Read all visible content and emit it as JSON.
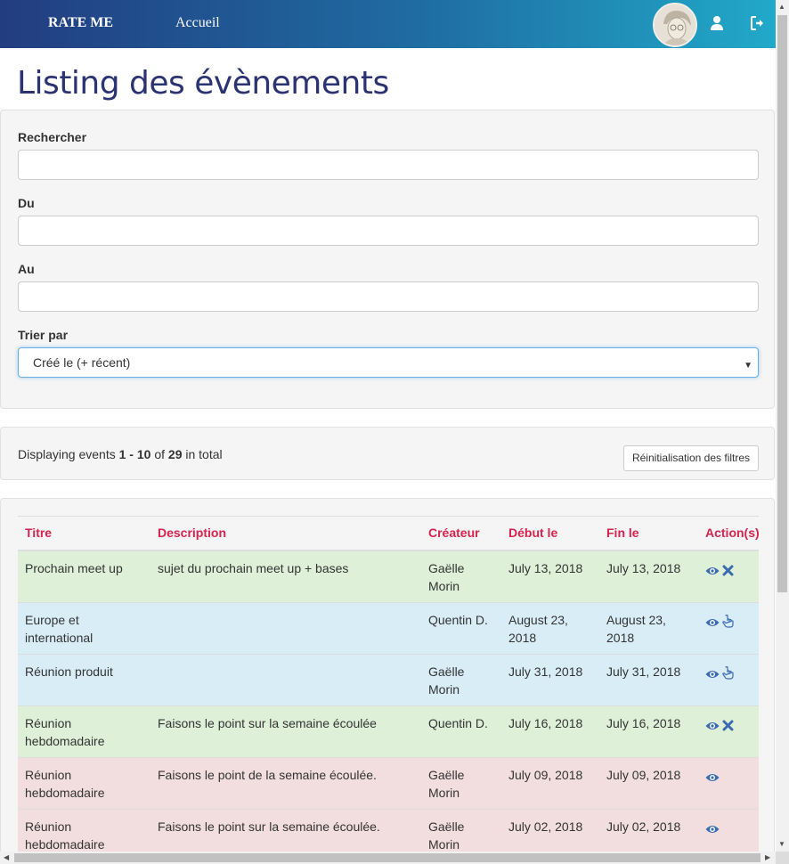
{
  "navbar": {
    "brand": "RATE ME",
    "home_link": "Accueil",
    "avatar_icon": "user-avatar",
    "profile_icon": "user-icon",
    "logout_icon": "sign-out-icon"
  },
  "page": {
    "title": "Listing des évènements"
  },
  "filters": {
    "search_label": "Rechercher",
    "search_value": "",
    "from_label": "Du",
    "from_value": "",
    "to_label": "Au",
    "to_value": "",
    "sort_label": "Trier par",
    "sort_selected": "Créé le (+ récent)"
  },
  "summary": {
    "prefix": "Displaying events ",
    "range": "1 - 10",
    "of": " of ",
    "total": "29",
    "suffix": " in total",
    "reset_label": "Réinitialisation des filtres"
  },
  "table": {
    "headers": [
      "Titre",
      "Description",
      "Créateur",
      "Début le",
      "Fin le",
      "Action(s)"
    ],
    "rows": [
      {
        "status": "success",
        "title": "Prochain meet up",
        "description": "sujet du prochain meet up + bases",
        "creator": "Gaëlle Morin",
        "start": "July 13, 2018",
        "end": "July 13, 2018",
        "actions": [
          "eye-icon",
          "remove-icon"
        ]
      },
      {
        "status": "info",
        "title": "Europe et international",
        "description": "",
        "creator": "Quentin D.",
        "start": "August 23, 2018",
        "end": "August 23, 2018",
        "actions": [
          "eye-icon",
          "hand-pointer-icon"
        ]
      },
      {
        "status": "info",
        "title": "Réunion produit",
        "description": "",
        "creator": "Gaëlle Morin",
        "start": "July 31, 2018",
        "end": "July 31, 2018",
        "actions": [
          "eye-icon",
          "hand-pointer-icon"
        ]
      },
      {
        "status": "success",
        "title": "Réunion hebdomadaire",
        "description": "Faisons le point sur la semaine écoulée",
        "creator": "Quentin D.",
        "start": "July 16, 2018",
        "end": "July 16, 2018",
        "actions": [
          "eye-icon",
          "remove-icon"
        ]
      },
      {
        "status": "danger",
        "title": "Réunion hebdomadaire",
        "description": "Faisons le point de la semaine écoulée.",
        "creator": "Gaëlle Morin",
        "start": "July 09, 2018",
        "end": "July 09, 2018",
        "actions": [
          "eye-icon"
        ]
      },
      {
        "status": "danger",
        "title": "Réunion hebdomadaire",
        "description": "Faisons le point sur la semaine écoulée.",
        "creator": "Gaëlle Morin",
        "start": "July 02, 2018",
        "end": "July 02, 2018",
        "actions": [
          "eye-icon"
        ]
      }
    ]
  },
  "colors": {
    "navbar_start": "#223d80",
    "navbar_end": "#21a9c9",
    "title": "#2b3373",
    "header_text": "#d6234f",
    "icon": "#3a6bb0",
    "row_success": "#dff0d8",
    "row_info": "#d9edf7",
    "row_danger": "#f2dede"
  }
}
